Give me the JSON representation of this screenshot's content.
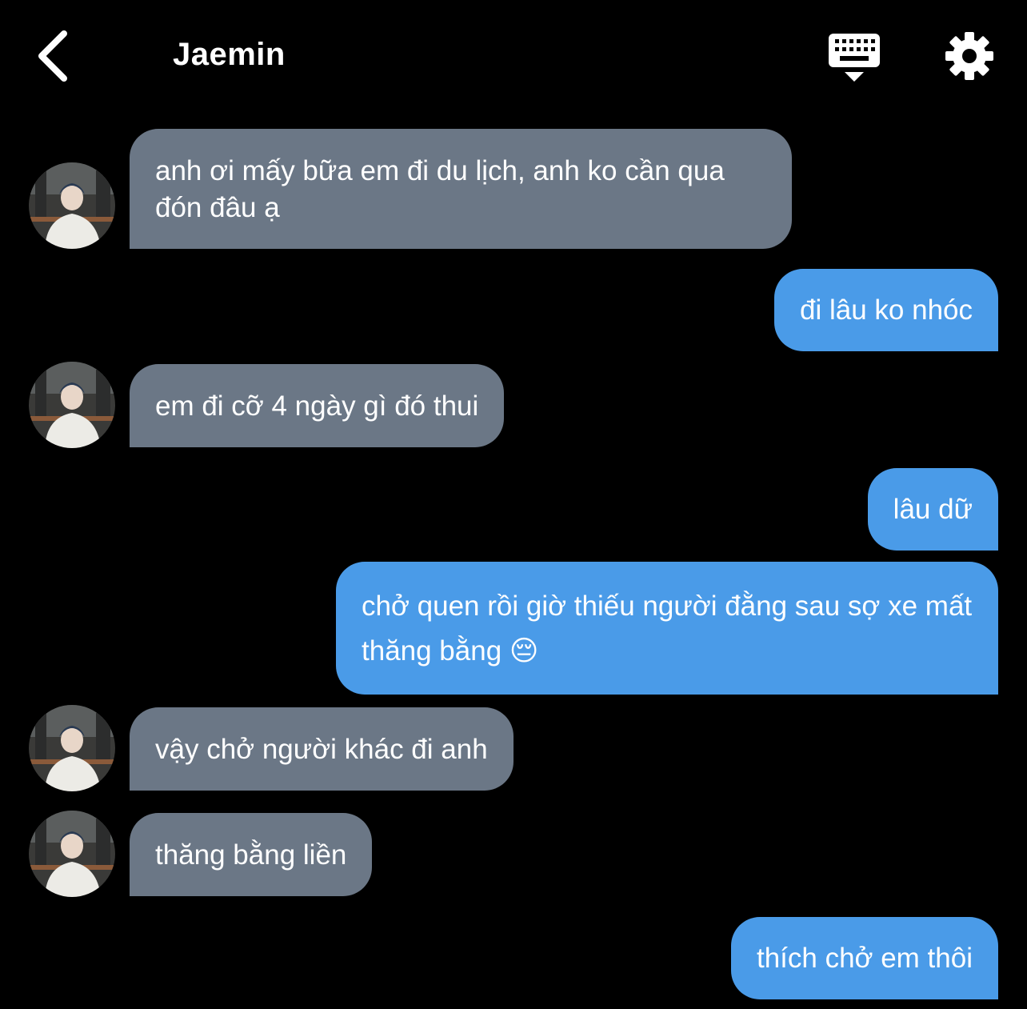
{
  "header": {
    "title": "Jaemin",
    "back_icon": "chevron-left-icon",
    "keyboard_icon": "keyboard-hide-icon",
    "settings_icon": "gear-icon"
  },
  "colors": {
    "background": "#000000",
    "incoming_bubble": "#6b7786",
    "outgoing_bubble": "#4a9be8",
    "text": "#ffffff"
  },
  "messages": [
    {
      "from": "contact",
      "text": "anh ơi mấy bữa em đi du lịch, anh ko cần qua đón đâu ạ"
    },
    {
      "from": "me",
      "text": "đi lâu ko nhóc"
    },
    {
      "from": "contact",
      "text": "em đi cỡ 4 ngày gì đó thui"
    },
    {
      "from": "me",
      "text": "lâu dữ"
    },
    {
      "from": "me",
      "text": "chở quen rồi giờ thiếu người đằng sau sợ xe mất thăng bằng 😔"
    },
    {
      "from": "contact",
      "text": "vậy chở người khác đi anh"
    },
    {
      "from": "contact",
      "text": "thăng bằng liền"
    },
    {
      "from": "me",
      "text": "thích chở em thôi"
    }
  ]
}
